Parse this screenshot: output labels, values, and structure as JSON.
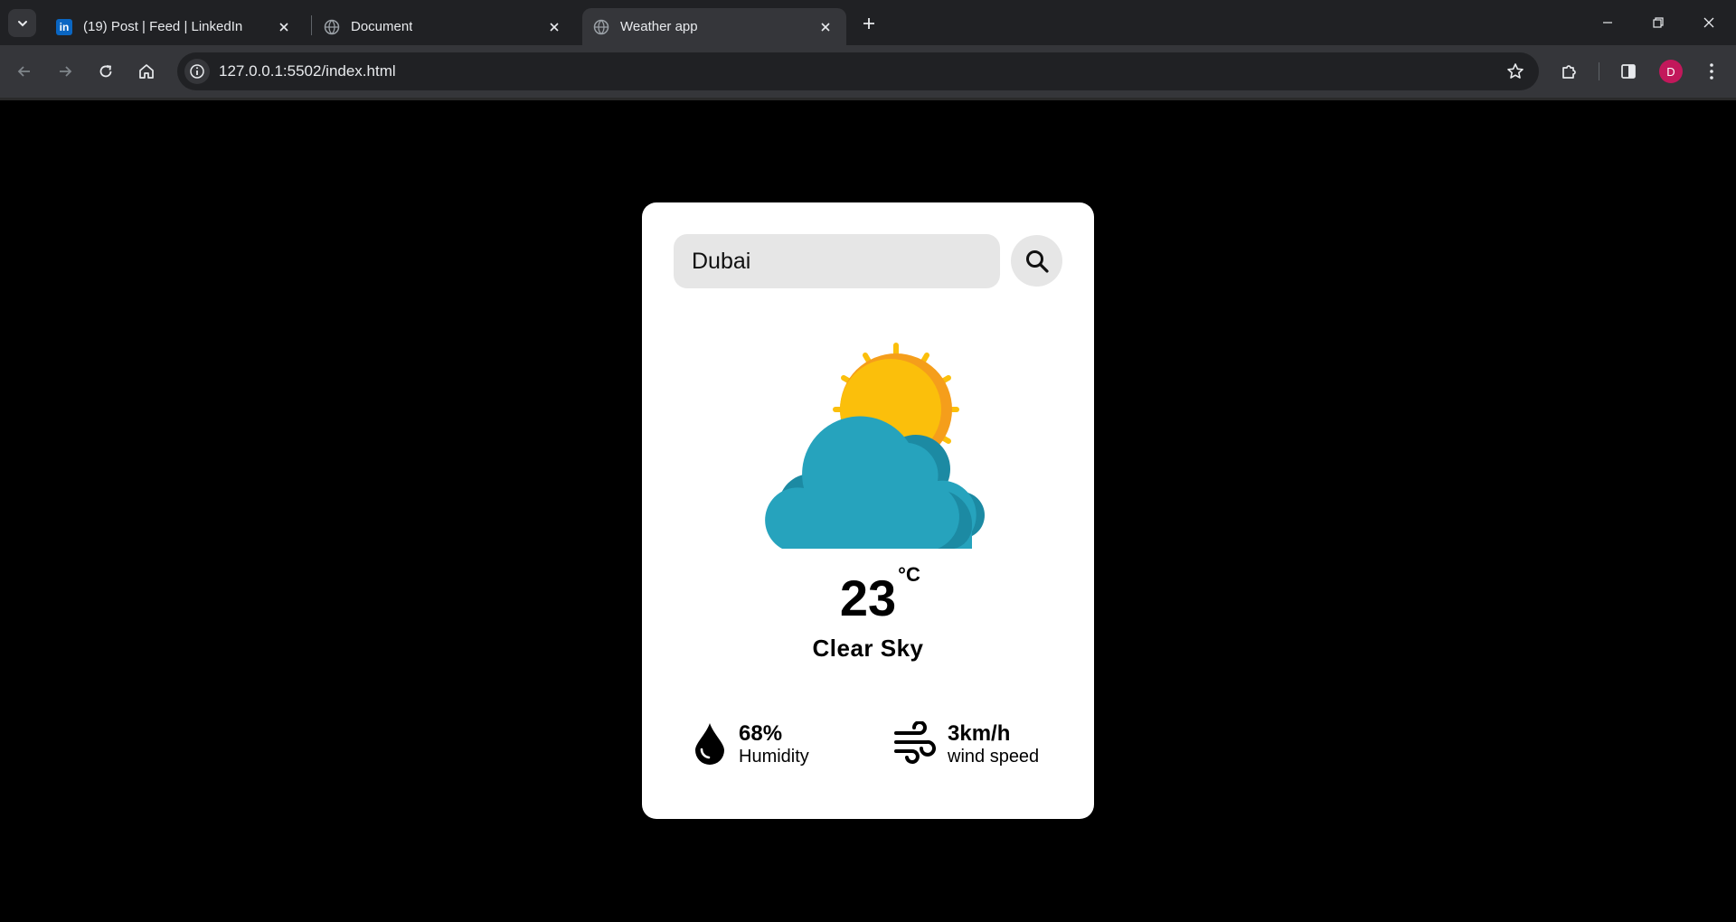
{
  "browser": {
    "tabs": [
      {
        "title": "(19) Post | Feed | LinkedIn",
        "icon": "linkedin-icon",
        "active": false
      },
      {
        "title": "Document",
        "icon": "globe-icon",
        "active": false
      },
      {
        "title": "Weather app",
        "icon": "globe-icon",
        "active": true
      }
    ],
    "url": "127.0.0.1:5502/index.html",
    "profile_initial": "D"
  },
  "weather": {
    "city_value": "Dubai",
    "icon": "sun-behind-cloud-icon",
    "temperature": "23",
    "unit": "°C",
    "condition": "Clear Sky",
    "humidity_value": "68%",
    "humidity_label": "Humidity",
    "wind_value": "3km/h",
    "wind_label": "wind speed"
  },
  "colors": {
    "page_background": "#000000",
    "card_background": "#ffffff",
    "input_background": "#e6e6e6",
    "sun": "#fbbf0b",
    "sun_shade": "#f59e1b",
    "cloud": "#26a3bd",
    "cloud_shade": "#1c8aa3"
  }
}
